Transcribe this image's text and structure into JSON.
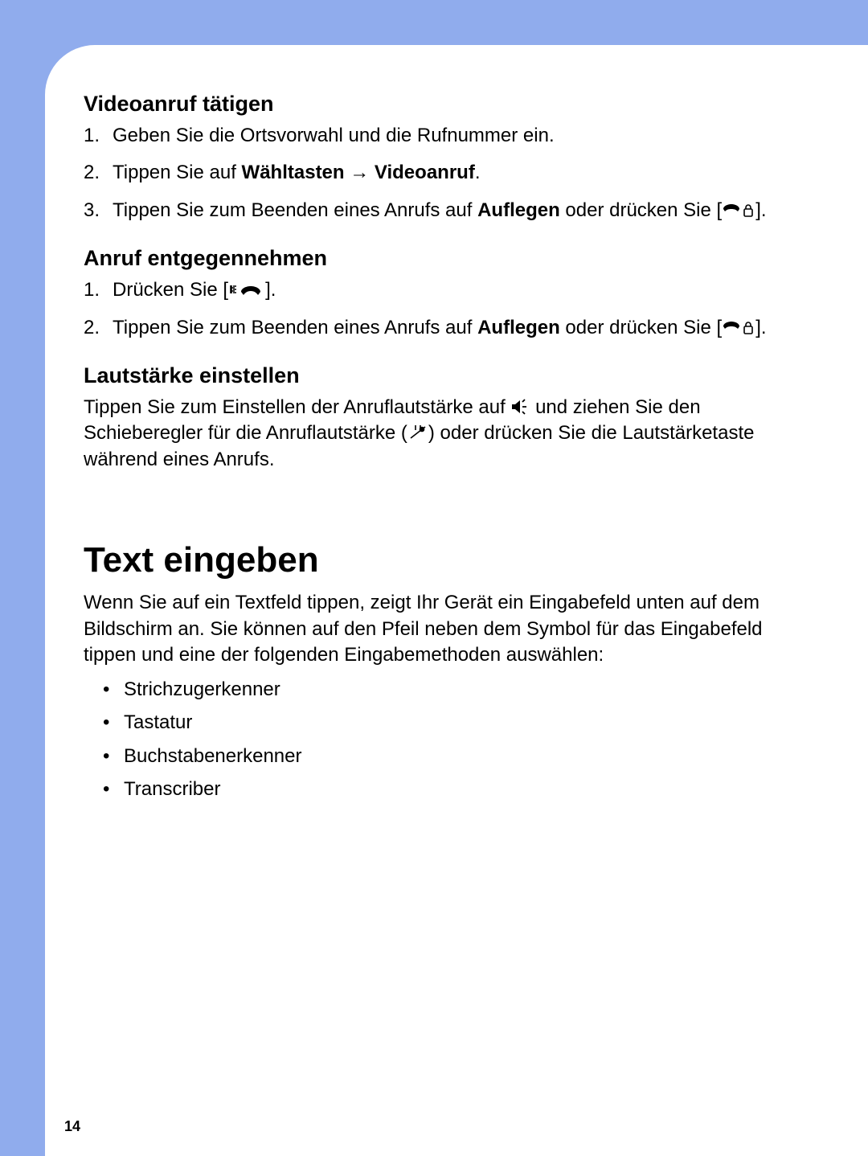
{
  "page_number": "14",
  "section1": {
    "heading": "Videoanruf tätigen",
    "items": {
      "i1_pre": "Geben Sie die Ortsvorwahl und die Rufnummer ein.",
      "i2_pre": "Tippen Sie auf ",
      "i2_b1": "Wähltasten",
      "i2_mid": " → ",
      "i2_b2": "Videoanruf",
      "i2_post": ".",
      "i3_pre": "Tippen Sie zum Beenden eines Anrufs auf ",
      "i3_b1": "Auflegen",
      "i3_mid": " oder drücken Sie [",
      "i3_post": "]."
    }
  },
  "section2": {
    "heading": "Anruf entgegennehmen",
    "items": {
      "i1_pre": "Drücken Sie [",
      "i1_post": "].",
      "i2_pre": "Tippen Sie zum Beenden eines Anrufs auf ",
      "i2_b1": "Auflegen",
      "i2_mid": " oder drücken Sie [",
      "i2_post": "]."
    }
  },
  "section3": {
    "heading": "Lautstärke einstellen",
    "p_pre": "Tippen Sie zum Einstellen der Anruflautstärke auf ",
    "p_mid": " und ziehen Sie den Schieberegler für die Anruflautstärke (",
    "p_post": ") oder drücken Sie die Lautstärketaste während eines Anrufs."
  },
  "section4": {
    "heading": "Text eingeben",
    "intro": "Wenn Sie auf ein Textfeld tippen, zeigt Ihr Gerät ein Eingabefeld unten auf dem Bildschirm an. Sie können auf den Pfeil neben dem Symbol für das Eingabefeld tippen und eine der folgenden Eingabemethoden auswählen:",
    "bullets": {
      "b1": "Strichzugerkenner",
      "b2": "Tastatur",
      "b3": "Buchstabenerkenner",
      "b4": "Transcriber"
    }
  },
  "icons": {
    "end_lock": "end-call-lock-icon",
    "send_call": "send-call-icon",
    "speaker": "speaker-icon",
    "slider": "volume-slider-icon"
  }
}
